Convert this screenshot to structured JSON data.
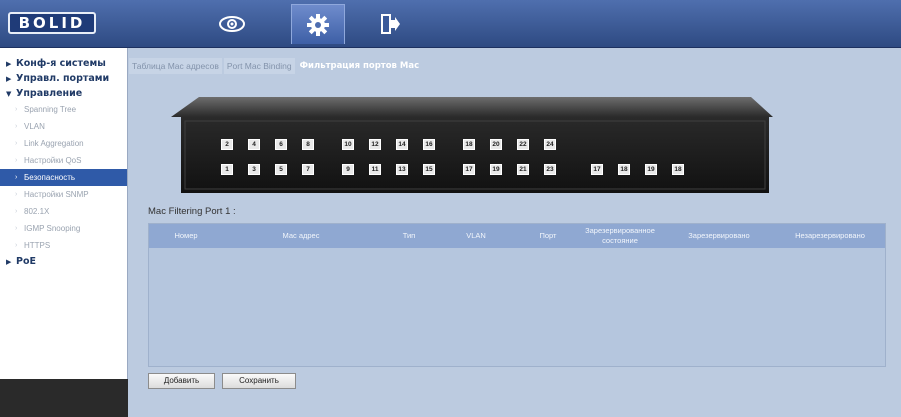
{
  "header": {
    "logo_text": "BOLID",
    "nav": [
      {
        "icon": "eye-icon"
      },
      {
        "icon": "gear-icon"
      },
      {
        "icon": "exit-icon"
      }
    ]
  },
  "sidebar": {
    "sections": [
      {
        "label": "Конф-я системы",
        "expanded": false
      },
      {
        "label": "Управл. портами",
        "expanded": false
      },
      {
        "label": "Управление",
        "expanded": true
      }
    ],
    "items": [
      "Spanning Tree",
      "VLAN",
      "Link Aggregation",
      "Настройки QoS",
      "Безопасность",
      "Настройки SNMP",
      "802.1X",
      "IGMP Snooping",
      "HTTPS"
    ],
    "active_index": 4,
    "poe_label": "PoE"
  },
  "tabs": [
    "Таблица Mac адресов",
    "Port Mac Binding",
    "Фильтрация портов Mac"
  ],
  "active_tab": 2,
  "switch": {
    "top_row": [
      "2",
      "4",
      "6",
      "8",
      "10",
      "12",
      "14",
      "16",
      "18",
      "20",
      "22",
      "24"
    ],
    "bottom_row": [
      "1",
      "3",
      "5",
      "7",
      "9",
      "11",
      "13",
      "15",
      "17",
      "19",
      "21",
      "23"
    ],
    "sfp_row": [
      "17",
      "18",
      "19",
      "18"
    ]
  },
  "filter": {
    "title": "Mac Filtering Port 1 :",
    "columns": [
      "Номер",
      "Мас адрес",
      "Тип",
      "VLAN",
      "Порт",
      "Зарезервированное состояние",
      "Зарезервировано",
      "Незарезервировано"
    ],
    "rows": []
  },
  "buttons": {
    "add": "Добавить",
    "save": "Сохранить"
  }
}
